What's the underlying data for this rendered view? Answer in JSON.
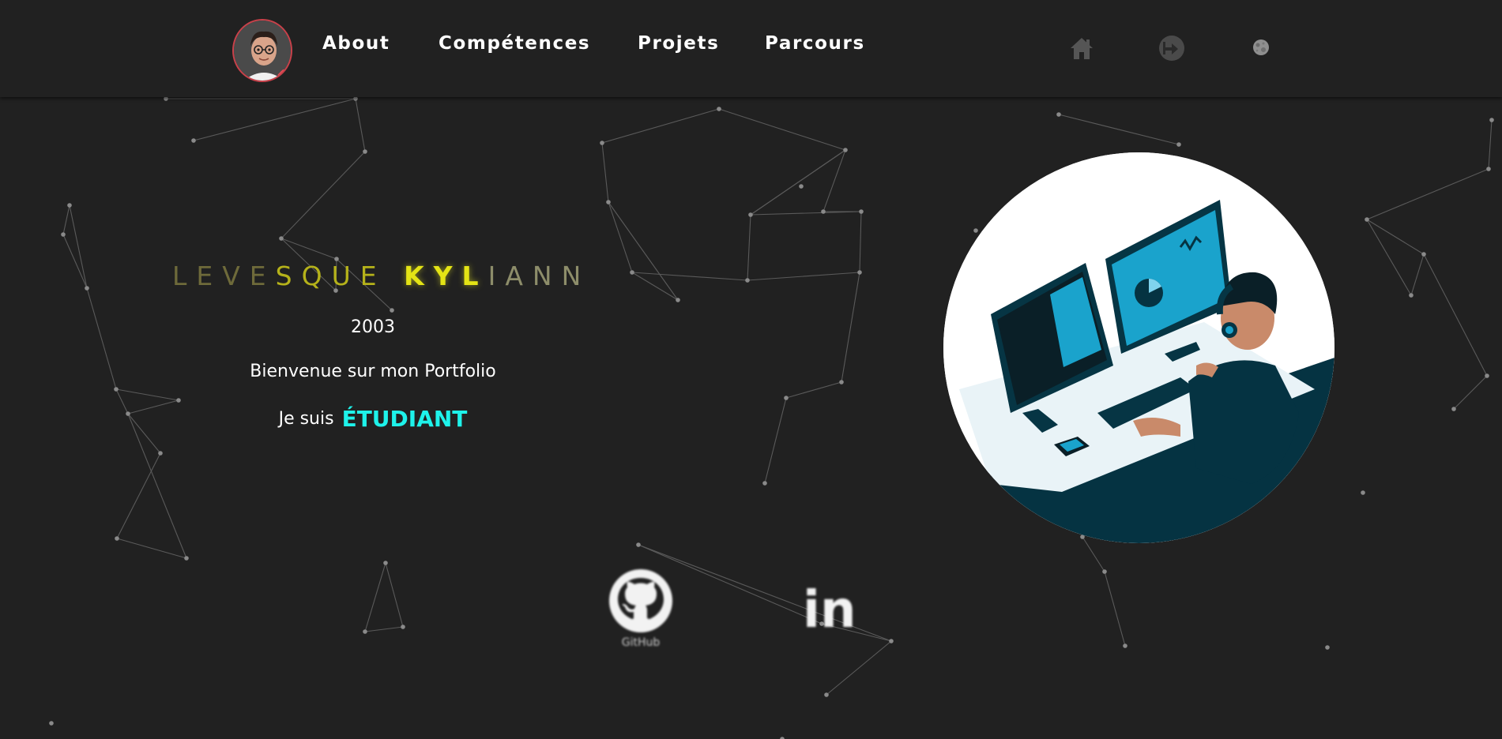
{
  "header": {
    "nav": [
      "About",
      "Compétences",
      "Projets",
      "Parcours"
    ],
    "icons": [
      "avatar",
      "home-icon",
      "logout-icon",
      "moon-icon"
    ]
  },
  "hero": {
    "name_parts": [
      {
        "text": "LEVE",
        "tone": "dim"
      },
      {
        "text": "SQUE ",
        "tone": "mid"
      },
      {
        "text": "KYL",
        "tone": "bright"
      },
      {
        "text": "IANN",
        "tone": "fade"
      }
    ],
    "year": "2003",
    "welcome": "Bienvenue sur mon Portfolio",
    "role_prefix": "Je suis",
    "role_value": "ÉTUDIANT"
  },
  "social": {
    "github_label": "GitHub",
    "linkedin_label": "in"
  },
  "colors": {
    "background": "#212121",
    "accent_cyan": "#1ef2ea",
    "accent_yellow": "#e4e415",
    "avatar_border": "#c9414a"
  }
}
